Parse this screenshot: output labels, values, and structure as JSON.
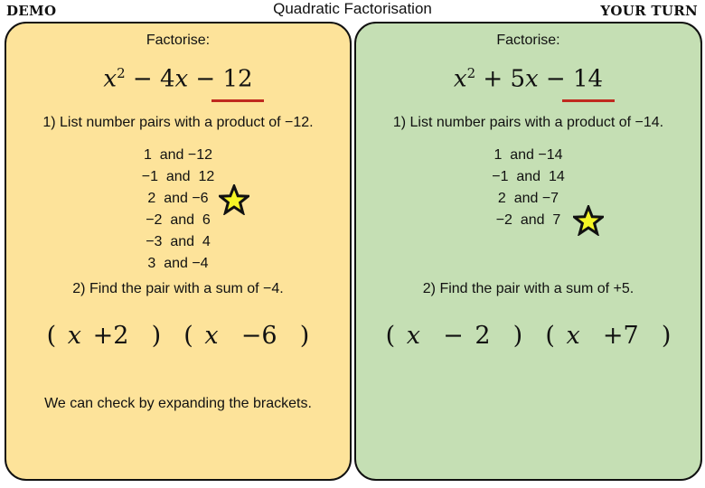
{
  "header": {
    "left_label": "DEMO",
    "title": "Quadratic Factorisation",
    "right_label": "YOUR TURN"
  },
  "demo": {
    "heading": "Factorise:",
    "expression": {
      "x": "x",
      "sq": "2",
      "op1": " − 4",
      "x2": "x",
      "op2": " − 12"
    },
    "step1": "1) List number pairs with a product of −12.",
    "pairs": [
      "1  and −12",
      "−1  and  12",
      "2  and −6",
      "−2  and  6",
      "−3  and  4",
      "3  and −4"
    ],
    "highlighted_pair": "2  and −6",
    "step2": "2) Find the pair with a sum of −4.",
    "answer": {
      "open1": "( ",
      "x1": "x",
      "rest1": " +2  )  ( ",
      "x2": "x",
      "rest2": "  −6  )"
    },
    "check_note": "We can check by expanding the brackets.",
    "background": "#fde39a"
  },
  "your_turn": {
    "heading": "Factorise:",
    "expression": {
      "x": "x",
      "sq": "2",
      "op1": " + 5",
      "x2": "x",
      "op2": " − 14"
    },
    "step1": "1) List number pairs with a product of −14.",
    "pairs": [
      "1  and −14",
      "−1  and  14",
      "2  and −7",
      "−2  and  7"
    ],
    "highlighted_pair": "−2  and  7",
    "step2": "2) Find the pair with a sum of +5.",
    "answer": {
      "open1": "( ",
      "x1": "x",
      "rest1": "  − 2  )  ( ",
      "x2": "x",
      "rest2": "  +7  )"
    },
    "background": "#c5dfb4"
  },
  "colors": {
    "underline": "#c0291f",
    "star_fill": "#f5f526",
    "star_outline": "#111111"
  },
  "icons": {
    "highlight": "star-icon"
  }
}
